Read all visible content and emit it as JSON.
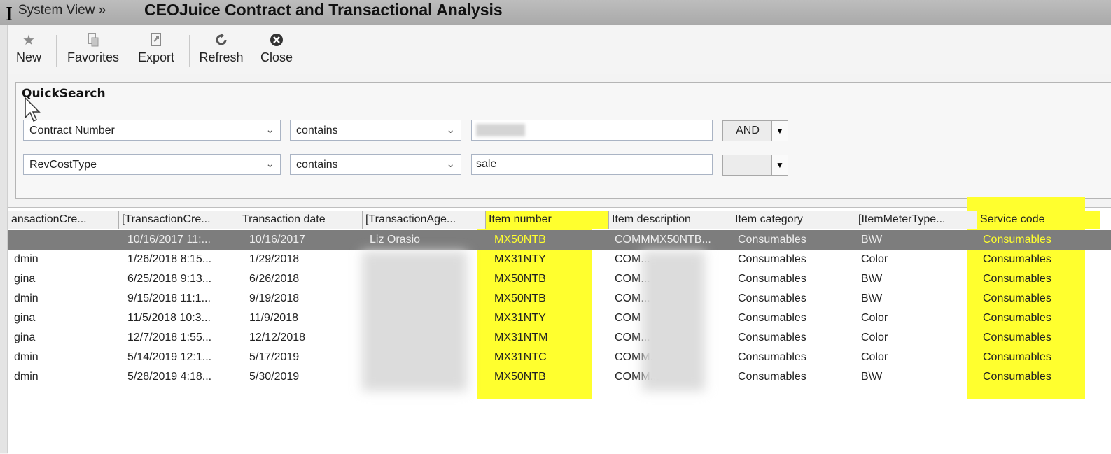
{
  "window": {
    "breadcrumb": "System View »",
    "title": "CEOJuice Contract and Transactional Analysis"
  },
  "toolbar": {
    "new_label": "New",
    "favorites_label": "Favorites",
    "export_label": "Export",
    "refresh_label": "Refresh",
    "close_label": "Close"
  },
  "quicksearch": {
    "title": "QuickSearch",
    "rows": [
      {
        "field": "Contract Number",
        "operator": "contains",
        "value": "",
        "logic": "AND"
      },
      {
        "field": "RevCostType",
        "operator": "contains",
        "value": "sale",
        "logic": ""
      }
    ]
  },
  "grid": {
    "columns": [
      "ansactionCre...",
      "[TransactionCre...",
      "Transaction date",
      "[TransactionAge...",
      "Item number",
      "Item description",
      "Item category",
      "[ItemMeterType...",
      "Service code"
    ],
    "rows": [
      {
        "user": "",
        "created": "10/16/2017 11:...",
        "date": "10/16/2017",
        "agent": "Liz Orasio",
        "item": "MX50NTB",
        "desc": "COMMMX50NTB...",
        "category": "Consumables",
        "meter": "B\\W",
        "service": "Consumables"
      },
      {
        "user": "dmin",
        "created": "1/26/2018 8:15...",
        "date": "1/29/2018",
        "agent": "",
        "item": "MX31NTY",
        "desc": "COM...",
        "category": "Consumables",
        "meter": "Color",
        "service": "Consumables"
      },
      {
        "user": "gina",
        "created": "6/25/2018 9:13...",
        "date": "6/26/2018",
        "agent": "",
        "item": "MX50NTB",
        "desc": "COM...",
        "category": "Consumables",
        "meter": "B\\W",
        "service": "Consumables"
      },
      {
        "user": "dmin",
        "created": "9/15/2018 11:1...",
        "date": "9/19/2018",
        "agent": "",
        "item": "MX50NTB",
        "desc": "COM...",
        "category": "Consumables",
        "meter": "B\\W",
        "service": "Consumables"
      },
      {
        "user": "gina",
        "created": "11/5/2018 10:3...",
        "date": "11/9/2018",
        "agent": "",
        "item": "MX31NTY",
        "desc": "COM",
        "category": "Consumables",
        "meter": "Color",
        "service": "Consumables"
      },
      {
        "user": "gina",
        "created": "12/7/2018 1:55...",
        "date": "12/12/2018",
        "agent": "",
        "item": "MX31NTM",
        "desc": "COM...",
        "category": "Consumables",
        "meter": "Color",
        "service": "Consumables"
      },
      {
        "user": "dmin",
        "created": "5/14/2019 12:1...",
        "date": "5/17/2019",
        "agent": "",
        "item": "MX31NTC",
        "desc": "COMM...",
        "category": "Consumables",
        "meter": "Color",
        "service": "Consumables"
      },
      {
        "user": "dmin",
        "created": "5/28/2019 4:18...",
        "date": "5/30/2019",
        "agent": "",
        "item": "MX50NTB",
        "desc": "COMM...",
        "category": "Consumables",
        "meter": "B\\W",
        "service": "Consumables"
      }
    ]
  },
  "colors": {
    "highlight": "#ffff2e",
    "selected_row": "#7d7d7d"
  }
}
